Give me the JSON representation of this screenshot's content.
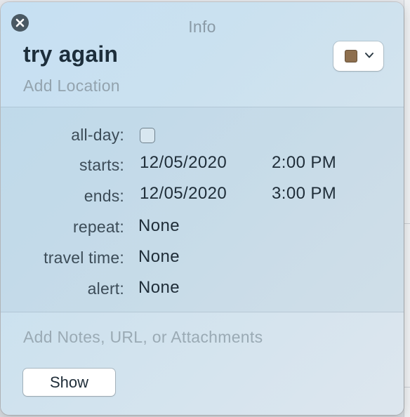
{
  "popover": {
    "title": "Info",
    "event_title": "try again",
    "location_placeholder": "Add Location",
    "calendar_color": "#8e6f4e"
  },
  "details": {
    "all_day": {
      "label": "all-day:",
      "checked": false
    },
    "starts": {
      "label": "starts:",
      "date": "12/05/2020",
      "time": "2:00 PM"
    },
    "ends": {
      "label": "ends:",
      "date": "12/05/2020",
      "time": "3:00 PM"
    },
    "repeat": {
      "label": "repeat:",
      "value": "None"
    },
    "travel_time": {
      "label": "travel time:",
      "value": "None"
    },
    "alert": {
      "label": "alert:",
      "value": "None"
    }
  },
  "notes": {
    "placeholder": "Add Notes, URL, or Attachments"
  },
  "actions": {
    "show_label": "Show"
  },
  "icons": {
    "close": "close-icon",
    "chevron": "chevron-down-icon"
  }
}
